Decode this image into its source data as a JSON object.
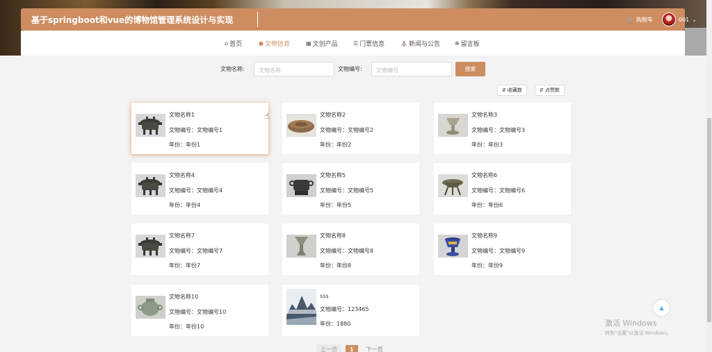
{
  "header": {
    "title": "基于springboot和vue的博物馆管理系统设计与实现",
    "cart_label": "购物车",
    "user_name": "001",
    "accent_color": "#cd8d61"
  },
  "nav": {
    "items": [
      {
        "label": "首页",
        "icon": "home-icon",
        "active": false
      },
      {
        "label": "文物信息",
        "icon": "circle-icon",
        "active": true
      },
      {
        "label": "文创产品",
        "icon": "grid-icon",
        "active": false
      },
      {
        "label": "门票信息",
        "icon": "list-icon",
        "active": false
      },
      {
        "label": "新闻与公告",
        "icon": "bank-icon",
        "active": false
      },
      {
        "label": "留言板",
        "icon": "plus-circle-icon",
        "active": false
      }
    ]
  },
  "search": {
    "name_label": "文物名称:",
    "name_placeholder": "文物名称",
    "code_label": "文物编号:",
    "code_placeholder": "文物编号",
    "button": "搜索"
  },
  "sort": {
    "favorites": "收藏数",
    "likes": "点赞数"
  },
  "cards": [
    {
      "name": "文物名称1",
      "code_label": "文物编号：",
      "code": "文物编号1",
      "year_label": "年份：",
      "year": "年份1",
      "thumb": "bronze-ding"
    },
    {
      "name": "文物名称2",
      "code_label": "文物编号：",
      "code": "文物编号2",
      "year_label": "年份：",
      "year": "年份2",
      "thumb": "bronze-disc"
    },
    {
      "name": "文物名称3",
      "code_label": "文物编号：",
      "code": "文物编号3",
      "year_label": "年份：",
      "year": "年份3",
      "thumb": "jade-cup"
    },
    {
      "name": "文物名称4",
      "code_label": "文物编号：",
      "code": "文物编号4",
      "year_label": "年份：",
      "year": "年份4",
      "thumb": "bronze-ding"
    },
    {
      "name": "文物名称5",
      "code_label": "文物编号：",
      "code": "文物编号5",
      "year_label": "年份：",
      "year": "年份5",
      "thumb": "bronze-gui"
    },
    {
      "name": "文物名称6",
      "code_label": "文物编号：",
      "code": "文物编号6",
      "year_label": "年份：",
      "year": "年份6",
      "thumb": "bronze-jue"
    },
    {
      "name": "文物名称7",
      "code_label": "文物编号：",
      "code": "文物编号7",
      "year_label": "年份：",
      "year": "年份7",
      "thumb": "bronze-ding"
    },
    {
      "name": "文物名称8",
      "code_label": "文物编号：",
      "code": "文物编号8",
      "year_label": "年份：",
      "year": "年份8",
      "thumb": "bronze-gu"
    },
    {
      "name": "文物名称9",
      "code_label": "文物编号：",
      "code": "文物编号9",
      "year_label": "年份：",
      "year": "年份9",
      "thumb": "enamel-cup"
    },
    {
      "name": "文物名称10",
      "code_label": "文物编号：",
      "code": "文物编号10",
      "year_label": "年份：",
      "year": "年份10",
      "thumb": "jade-pot"
    },
    {
      "name": "sss",
      "code_label": "文物编号：",
      "code": "123465",
      "year_label": "年份：",
      "year": "1880",
      "thumb": "landscape"
    }
  ],
  "pager": {
    "prev": "上一页",
    "current": "1",
    "next": "下一页"
  },
  "windows_activation": {
    "line1": "激活 Windows",
    "line2": "转到\"设置\"以激活 Windows。"
  }
}
